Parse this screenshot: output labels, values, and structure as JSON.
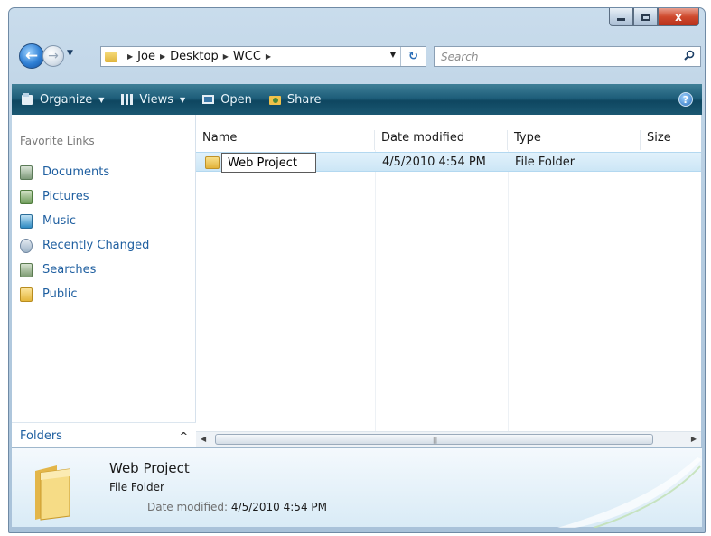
{
  "window": {
    "caption_close": "x"
  },
  "navigation": {
    "breadcrumbs": [
      "Joe",
      "Desktop",
      "WCC"
    ],
    "search_placeholder": "Search"
  },
  "command_bar": {
    "organize": "Organize",
    "views": "Views",
    "open": "Open",
    "share": "Share"
  },
  "nav_pane": {
    "favorite_links_title": "Favorite Links",
    "items": [
      {
        "label": "Documents",
        "icon": "documents-icon"
      },
      {
        "label": "Pictures",
        "icon": "pictures-icon"
      },
      {
        "label": "Music",
        "icon": "music-icon"
      },
      {
        "label": "Recently Changed",
        "icon": "recently-changed-icon"
      },
      {
        "label": "Searches",
        "icon": "searches-icon"
      },
      {
        "label": "Public",
        "icon": "public-folder-icon"
      }
    ],
    "folders_label": "Folders"
  },
  "file_list": {
    "columns": [
      "Name",
      "Date modified",
      "Type",
      "Size"
    ],
    "rows": [
      {
        "name": "Web Project",
        "date_modified": "4/5/2010 4:54 PM",
        "type": "File Folder",
        "size": ""
      }
    ]
  },
  "details": {
    "name": "Web Project",
    "type": "File Folder",
    "date_label": "Date modified:",
    "date_value": "4/5/2010 4:54 PM"
  },
  "colors": {
    "command_bar": "#1e5e7a",
    "link_blue": "#1f5fa0",
    "selection": "#cce6f6"
  }
}
